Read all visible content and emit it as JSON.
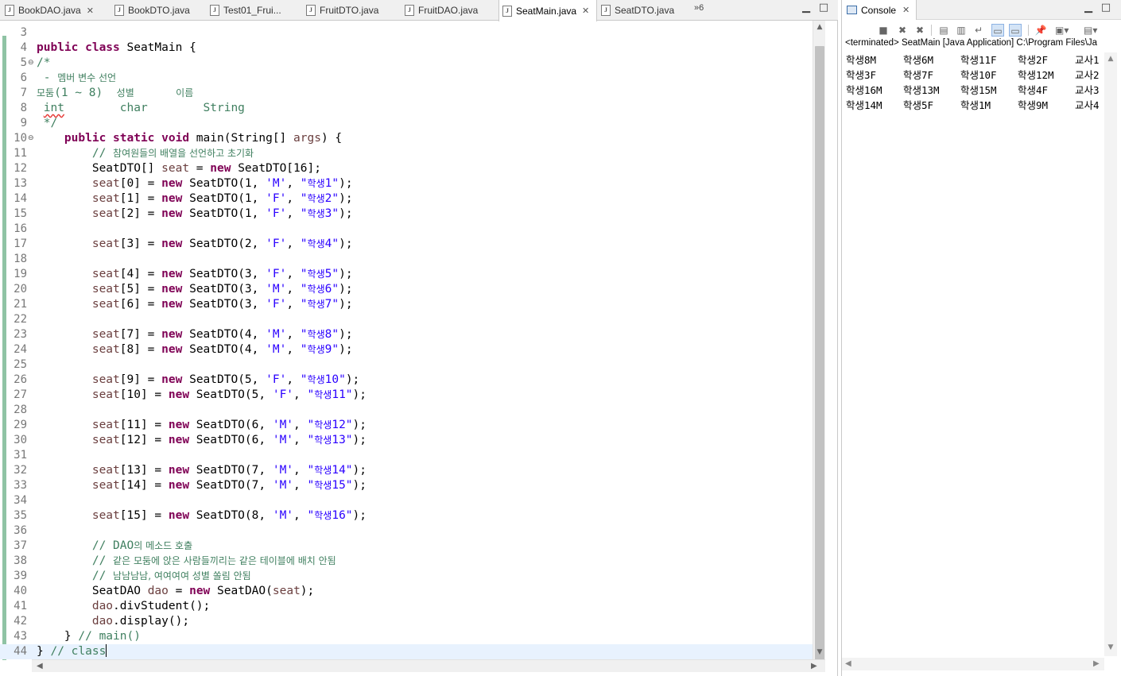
{
  "editor": {
    "tabs": [
      {
        "label": "BookDAO.java",
        "closable": true,
        "active": false
      },
      {
        "label": "BookDTO.java",
        "closable": false,
        "active": false
      },
      {
        "label": "Test01_Frui...",
        "closable": false,
        "active": false
      },
      {
        "label": "FruitDTO.java",
        "closable": false,
        "active": false
      },
      {
        "label": "FruitDAO.java",
        "closable": false,
        "active": false
      },
      {
        "label": "SeatMain.java",
        "closable": true,
        "active": true
      },
      {
        "label": "SeatDTO.java",
        "closable": false,
        "active": false
      }
    ],
    "overflow_label": "»6",
    "minimize_icon": "minimize-icon",
    "maximize_icon": "maximize-icon",
    "lines": [
      {
        "n": "3",
        "html": ""
      },
      {
        "n": "4",
        "html": "<span class='k'>public class</span> SeatMain {"
      },
      {
        "n": "5",
        "fold": true,
        "html": "<span class='c'>/*</span>"
      },
      {
        "n": "6",
        "html": "<span class='c'> - <span class='korc'>멤버 변수 선언</span></span>"
      },
      {
        "n": "7",
        "html": "<span class='c'><span class='korc'>모둠</span>(1 ~ 8)  <span class='korc'>성별</span>      <span class='korc'>이름</span></span>"
      },
      {
        "n": "8",
        "html": "<span class='c'> <span class='squiggle'>int</span>        char        String</span>"
      },
      {
        "n": "9",
        "html": "<span class='c'> */</span>"
      },
      {
        "n": "10",
        "fold": true,
        "html": "    <span class='k'>public static void</span> main(String[] <span class='v'>args</span>) {"
      },
      {
        "n": "11",
        "html": "        <span class='c'>// <span class='korc'>참여원들의 배열을 선언하고 초기화</span></span>"
      },
      {
        "n": "12",
        "html": "        SeatDTO[] <span class='v'>seat</span> = <span class='k'>new</span> SeatDTO[16];"
      },
      {
        "n": "13",
        "html": "        <span class='v'>seat</span>[0] = <span class='k'>new</span> SeatDTO(1, <span class='s'>'M'</span>, <span class='s'>\"<span class='korc'>학생</span>1\"</span>);"
      },
      {
        "n": "14",
        "html": "        <span class='v'>seat</span>[1] = <span class='k'>new</span> SeatDTO(1, <span class='s'>'F'</span>, <span class='s'>\"<span class='korc'>학생</span>2\"</span>);"
      },
      {
        "n": "15",
        "html": "        <span class='v'>seat</span>[2] = <span class='k'>new</span> SeatDTO(1, <span class='s'>'F'</span>, <span class='s'>\"<span class='korc'>학생</span>3\"</span>);"
      },
      {
        "n": "16",
        "html": ""
      },
      {
        "n": "17",
        "html": "        <span class='v'>seat</span>[3] = <span class='k'>new</span> SeatDTO(2, <span class='s'>'F'</span>, <span class='s'>\"<span class='korc'>학생</span>4\"</span>);"
      },
      {
        "n": "18",
        "html": ""
      },
      {
        "n": "19",
        "html": "        <span class='v'>seat</span>[4] = <span class='k'>new</span> SeatDTO(3, <span class='s'>'F'</span>, <span class='s'>\"<span class='korc'>학생</span>5\"</span>);"
      },
      {
        "n": "20",
        "html": "        <span class='v'>seat</span>[5] = <span class='k'>new</span> SeatDTO(3, <span class='s'>'M'</span>, <span class='s'>\"<span class='korc'>학생</span>6\"</span>);"
      },
      {
        "n": "21",
        "html": "        <span class='v'>seat</span>[6] = <span class='k'>new</span> SeatDTO(3, <span class='s'>'F'</span>, <span class='s'>\"<span class='korc'>학생</span>7\"</span>);"
      },
      {
        "n": "22",
        "html": ""
      },
      {
        "n": "23",
        "html": "        <span class='v'>seat</span>[7] = <span class='k'>new</span> SeatDTO(4, <span class='s'>'M'</span>, <span class='s'>\"<span class='korc'>학생</span>8\"</span>);"
      },
      {
        "n": "24",
        "html": "        <span class='v'>seat</span>[8] = <span class='k'>new</span> SeatDTO(4, <span class='s'>'M'</span>, <span class='s'>\"<span class='korc'>학생</span>9\"</span>);"
      },
      {
        "n": "25",
        "html": ""
      },
      {
        "n": "26",
        "html": "        <span class='v'>seat</span>[9] = <span class='k'>new</span> SeatDTO(5, <span class='s'>'F'</span>, <span class='s'>\"<span class='korc'>학생</span>10\"</span>);"
      },
      {
        "n": "27",
        "html": "        <span class='v'>seat</span>[10] = <span class='k'>new</span> SeatDTO(5, <span class='s'>'F'</span>, <span class='s'>\"<span class='korc'>학생</span>11\"</span>);"
      },
      {
        "n": "28",
        "html": ""
      },
      {
        "n": "29",
        "html": "        <span class='v'>seat</span>[11] = <span class='k'>new</span> SeatDTO(6, <span class='s'>'M'</span>, <span class='s'>\"<span class='korc'>학생</span>12\"</span>);"
      },
      {
        "n": "30",
        "html": "        <span class='v'>seat</span>[12] = <span class='k'>new</span> SeatDTO(6, <span class='s'>'M'</span>, <span class='s'>\"<span class='korc'>학생</span>13\"</span>);"
      },
      {
        "n": "31",
        "html": ""
      },
      {
        "n": "32",
        "html": "        <span class='v'>seat</span>[13] = <span class='k'>new</span> SeatDTO(7, <span class='s'>'M'</span>, <span class='s'>\"<span class='korc'>학생</span>14\"</span>);"
      },
      {
        "n": "33",
        "html": "        <span class='v'>seat</span>[14] = <span class='k'>new</span> SeatDTO(7, <span class='s'>'M'</span>, <span class='s'>\"<span class='korc'>학생</span>15\"</span>);"
      },
      {
        "n": "34",
        "html": ""
      },
      {
        "n": "35",
        "html": "        <span class='v'>seat</span>[15] = <span class='k'>new</span> SeatDTO(8, <span class='s'>'M'</span>, <span class='s'>\"<span class='korc'>학생</span>16\"</span>);"
      },
      {
        "n": "36",
        "html": ""
      },
      {
        "n": "37",
        "html": "        <span class='c'>// DAO<span class='korc'>의 메소드 호출</span></span>"
      },
      {
        "n": "38",
        "html": "        <span class='c'>// <span class='korc'>같은 모둠에 앉은 사람들끼리는 같은 테이블에 배치 안됨</span></span>"
      },
      {
        "n": "39",
        "html": "        <span class='c'>// <span class='korc'>남남남남, 여여여여 성별 쏠림 안됨</span></span>"
      },
      {
        "n": "40",
        "html": "        SeatDAO <span class='v'>dao</span> = <span class='k'>new</span> SeatDAO(<span class='v'>seat</span>);"
      },
      {
        "n": "41",
        "html": "        <span class='v'>dao</span>.divStudent();"
      },
      {
        "n": "42",
        "html": "        <span class='v'>dao</span>.display();"
      },
      {
        "n": "43",
        "html": "    } <span class='c'>// main()</span>"
      },
      {
        "n": "44",
        "current": true,
        "html": "} <span class='c'>// class</span><span class='caret'></span>"
      }
    ]
  },
  "console": {
    "tab_label": "Console",
    "status": "<terminated> SeatMain [Java Application] C:\\Program Files\\Ja",
    "toolbar_icons": [
      "terminate-icon",
      "remove-launch-icon",
      "remove-all-icon",
      "clear-console-icon",
      "scroll-lock-icon",
      "word-wrap-icon",
      "show-on-stdout-icon",
      "show-on-stderr-icon",
      "pin-console-icon",
      "display-console-icon",
      "open-console-icon"
    ],
    "rows": [
      [
        "학생8M",
        "학생6M",
        "학생11F",
        "학생2F",
        "교사1"
      ],
      [
        "학생3F",
        "학생7F",
        "학생10F",
        "학생12M",
        "교사2"
      ],
      [
        "학생16M",
        "학생13M",
        "학생15M",
        "학생4F",
        "교사3"
      ],
      [
        "학생14M",
        "학생5F",
        "학생1M",
        "학생9M",
        "교사4"
      ]
    ]
  },
  "colors": {
    "keyword": "#7f0055",
    "string": "#2a00ff",
    "comment": "#3f7f5f",
    "local_variable": "#6a3e3e",
    "current_line": "#e8f2fe",
    "change_marker": "#8fc3a4"
  }
}
